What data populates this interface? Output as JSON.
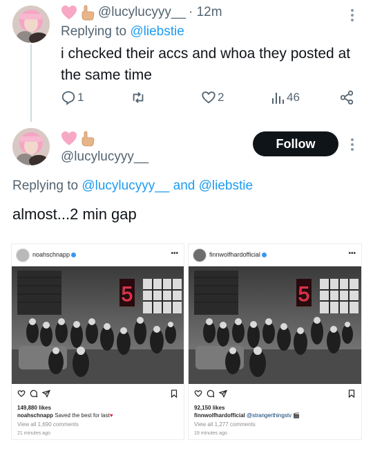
{
  "tweet1": {
    "handle": "@lucylucyyy__",
    "time": "· 12m",
    "replying_prefix": "Replying to ",
    "replying_handle": "@liebstie",
    "text": "i checked their accs and whoa they posted at the same time",
    "replies": "1",
    "likes": "2",
    "views": "46",
    "name_emoji": [
      "pink-heart-icon",
      "pointing-hand-icon"
    ]
  },
  "tweet2": {
    "handle": "@lucylucyyy__",
    "follow_label": "Follow",
    "replying_prefix": "Replying to ",
    "replying_handle1": "@lucylucyyy__",
    "replying_and": " and ",
    "replying_handle2": "@liebstie",
    "text": "almost...2 min gap"
  },
  "insta_left": {
    "username": "noahschnapp",
    "likes": "149,880 likes",
    "caption_user": "noahschnapp",
    "caption_text": " Saved the best for last",
    "comments": "View all 1,690 comments",
    "ago": "21 minutes ago",
    "neon": "5"
  },
  "insta_right": {
    "username": "finnwolfhardofficial",
    "likes": "92,150 likes",
    "caption_user": "finnwolfhardofficial",
    "caption_text": " @strangerthingstv",
    "comments": "View all 1,277 comments",
    "ago": "19 minutes ago",
    "neon": "5"
  },
  "colors": {
    "link": "#1d9bf0",
    "muted": "#536471",
    "text": "#0f1419",
    "follow_bg": "#0f1419",
    "neon": "#e0213a"
  }
}
